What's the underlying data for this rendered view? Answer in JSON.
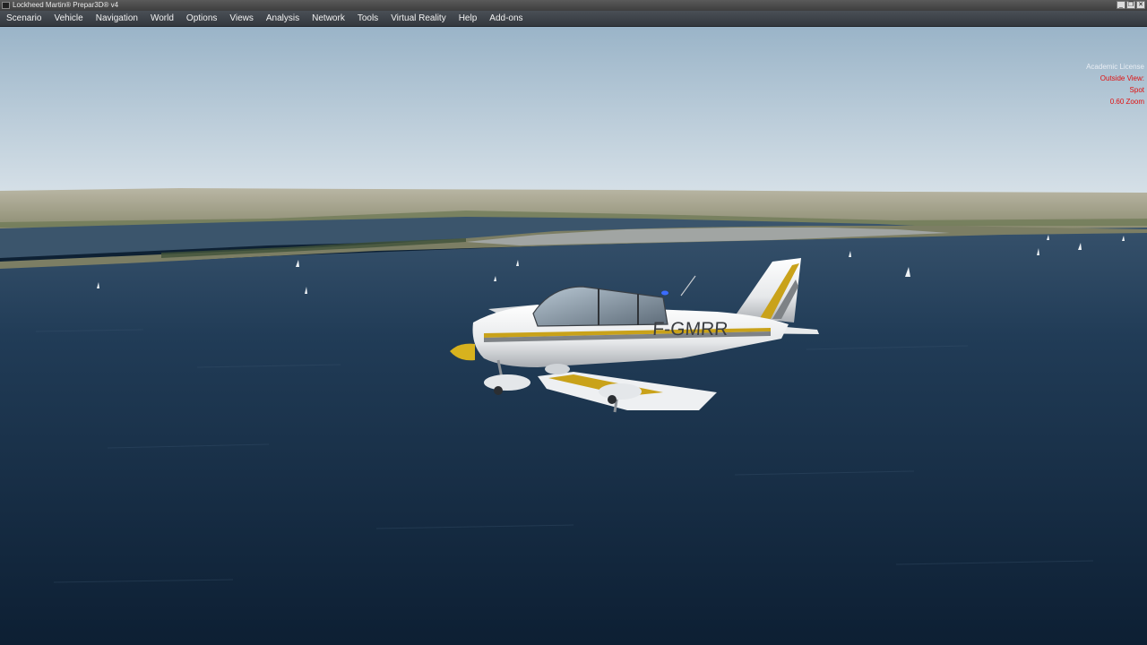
{
  "window": {
    "title": "Lockheed Martin® Prepar3D® v4",
    "controls": {
      "minimize": "_",
      "restore": "❐",
      "close": "✕"
    }
  },
  "menu": {
    "items": [
      "Scenario",
      "Vehicle",
      "Navigation",
      "World",
      "Options",
      "Views",
      "Analysis",
      "Network",
      "Tools",
      "Virtual Reality",
      "Help",
      "Add-ons"
    ]
  },
  "hud": {
    "license": "Academic License",
    "view_mode": "Outside View:",
    "camera": "Spot",
    "zoom": "0.60 Zoom"
  },
  "aircraft": {
    "registration": "F-GMRR"
  },
  "colors": {
    "hud_text": "#e01010",
    "sky_top": "#9ab4c8",
    "water": "#1b3550",
    "aircraft_stripe": "#c9a21a"
  }
}
